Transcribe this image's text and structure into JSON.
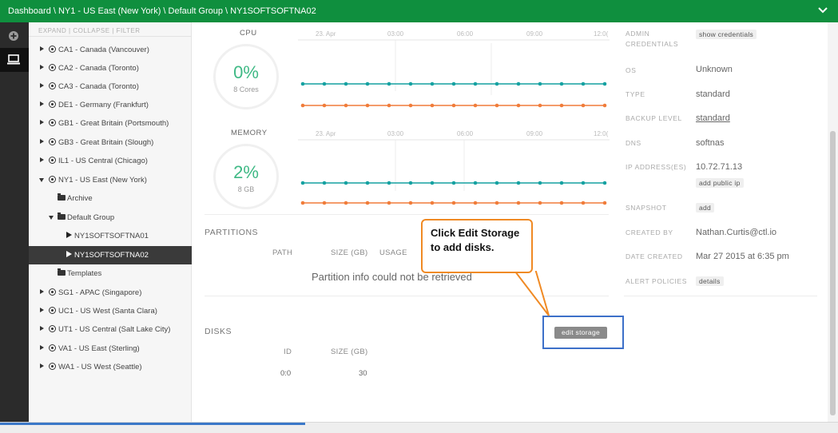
{
  "breadcrumb": "Dashboard \\ NY1 - US East (New York) \\ Default Group \\ NY1SOFTSOFTNA02",
  "tree": {
    "header": "EXPAND | COLLAPSE | FILTER",
    "items": [
      {
        "label": "CA1 - Canada (Vancouver)"
      },
      {
        "label": "CA2 - Canada (Toronto)"
      },
      {
        "label": "CA3 - Canada (Toronto)"
      },
      {
        "label": "DE1 - Germany (Frankfurt)"
      },
      {
        "label": "GB1 - Great Britain (Portsmouth)"
      },
      {
        "label": "GB3 - Great Britain (Slough)"
      },
      {
        "label": "IL1 - US Central (Chicago)"
      },
      {
        "label": "NY1 - US East (New York)"
      },
      {
        "label": "Archive"
      },
      {
        "label": "Default Group"
      },
      {
        "label": "NY1SOFTSOFTNA01"
      },
      {
        "label": "NY1SOFTSOFTNA02"
      },
      {
        "label": "Templates"
      },
      {
        "label": "SG1 - APAC (Singapore)"
      },
      {
        "label": "UC1 - US West (Santa Clara)"
      },
      {
        "label": "UT1 - US Central (Salt Lake City)"
      },
      {
        "label": "VA1 - US East (Sterling)"
      },
      {
        "label": "WA1 - US West (Seattle)"
      }
    ]
  },
  "cpu": {
    "title": "CPU",
    "value": "0%",
    "sub": "8 Cores"
  },
  "memory": {
    "title": "MEMORY",
    "value": "2%",
    "sub": "8 GB"
  },
  "chart_ticks": [
    "23. Apr",
    "03:00",
    "06:00",
    "09:00",
    "12:0("
  ],
  "partitions": {
    "title": "PARTITIONS",
    "col_path": "PATH",
    "col_size": "SIZE (GB)",
    "col_usage": "USAGE",
    "message": "Partition info could not be retrieved"
  },
  "disks": {
    "title": "DISKS",
    "col_id": "ID",
    "col_size": "SIZE (GB)",
    "rows": [
      {
        "id": "0:0",
        "size": "30"
      }
    ],
    "edit_label": "edit storage"
  },
  "callout": "Click Edit Storage to add disks.",
  "props": {
    "admin_label": "ADMIN CREDENTIALS",
    "admin_btn": "show credentials",
    "os_label": "OS",
    "os_val": "Unknown",
    "type_label": "TYPE",
    "type_val": "standard",
    "backup_label": "BACKUP LEVEL",
    "backup_val": "standard",
    "dns_label": "DNS",
    "dns_val": "softnas",
    "ip_label": "IP ADDRESS(ES)",
    "ip_val": "10.72.71.13",
    "ip_btn": "add public ip",
    "snapshot_label": "SNAPSHOT",
    "snapshot_btn": "add",
    "created_by_label": "CREATED BY",
    "created_by_val": "Nathan.Curtis@ctl.io",
    "date_label": "DATE CREATED",
    "date_val": "Mar 27 2015 at 6:35 pm",
    "alert_label": "ALERT POLICIES",
    "alert_btn": "details"
  },
  "colors": {
    "header": "#0f8f3e",
    "teal": "#15a1a1",
    "orange": "#f07c3a",
    "callout": "#f08a24",
    "highlight": "#3d70c9"
  }
}
